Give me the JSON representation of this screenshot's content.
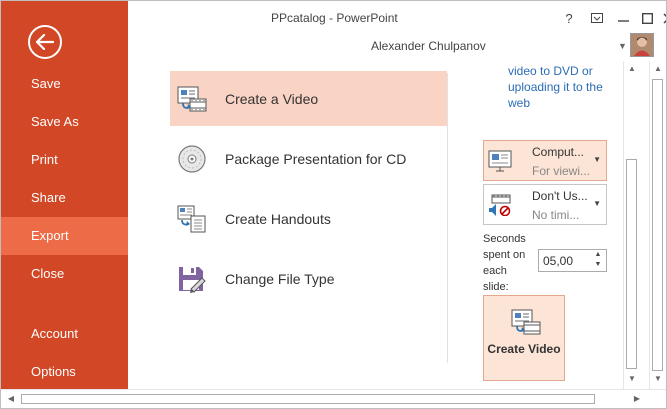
{
  "window": {
    "title": "PPcatalog - PowerPoint",
    "help": "?",
    "user_name": "Alexander Chulpanov"
  },
  "sidebar": {
    "items": [
      {
        "label": "Save"
      },
      {
        "label": "Save As"
      },
      {
        "label": "Print"
      },
      {
        "label": "Share"
      },
      {
        "label": "Export"
      },
      {
        "label": "Close"
      },
      {
        "label": "Account"
      },
      {
        "label": "Options"
      }
    ],
    "active": "Export"
  },
  "export_options": [
    {
      "label": "Create a Video",
      "icon": "video-icon"
    },
    {
      "label": "Package Presentation for CD",
      "icon": "cd-icon"
    },
    {
      "label": "Create Handouts",
      "icon": "handouts-icon"
    },
    {
      "label": "Change File Type",
      "icon": "file-type-icon"
    }
  ],
  "detail": {
    "description": "video to DVD or uploading it to the web",
    "quality_dropdown": {
      "main": "Comput...",
      "sub": "For viewi..."
    },
    "narration_dropdown": {
      "main": "Don't Us...",
      "sub": "No timi..."
    },
    "seconds_label": "Seconds spent on each slide:",
    "seconds_value": "05,00",
    "create_button": "Create Video"
  },
  "colors": {
    "sidebar": "#d24726",
    "sidebar_active": "#ed6c47",
    "selection": "#f9d3c4",
    "link": "#2b6cb5"
  }
}
